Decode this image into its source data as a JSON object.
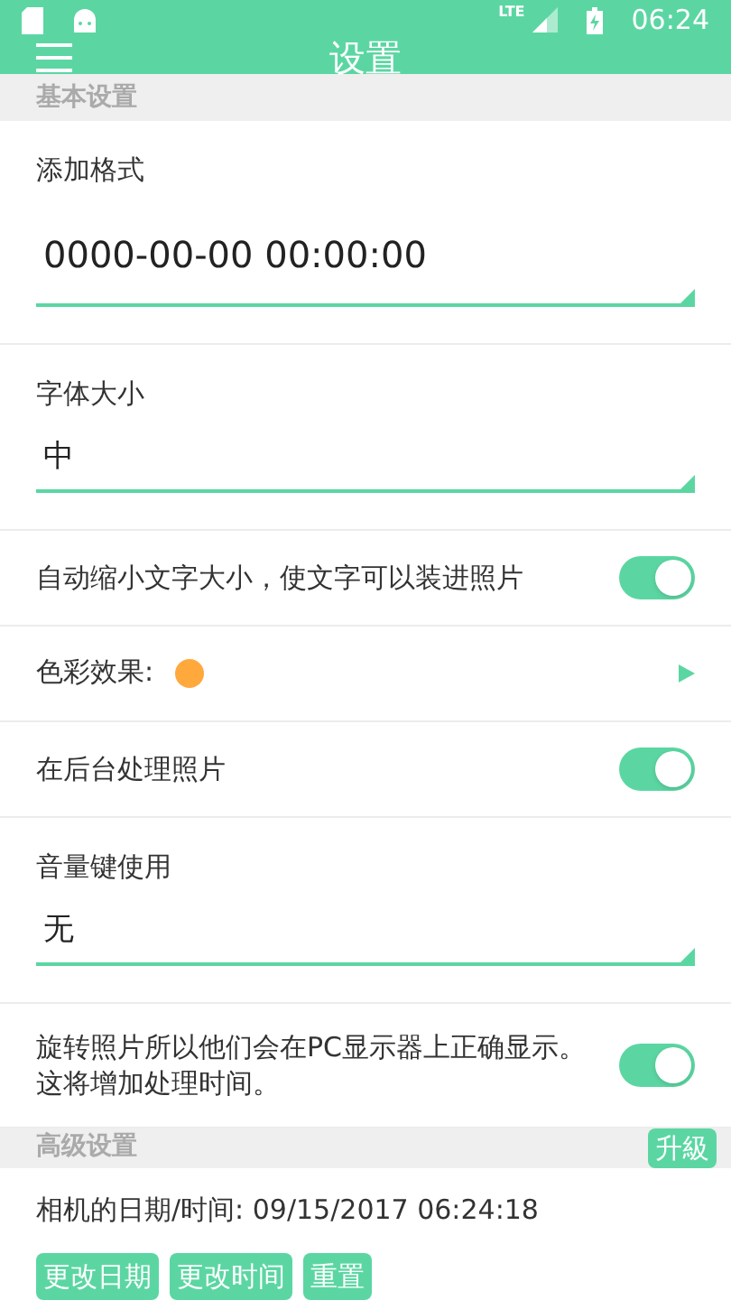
{
  "status_bar": {
    "time": "06:24",
    "network": "LTE"
  },
  "toolbar": {
    "title": "设置"
  },
  "sections": [
    {
      "header": "基本设置",
      "items": [
        {
          "kind": "field",
          "label": "添加格式",
          "value": "0000-00-00 00:00:00",
          "large": true
        },
        {
          "kind": "field",
          "label": "字体大小",
          "value": "中",
          "large": false
        },
        {
          "kind": "toggle",
          "label": "自动缩小文字大小，使文字可以装进照片",
          "on": true
        },
        {
          "kind": "color",
          "label": "色彩效果:",
          "color": "#ffa83c"
        },
        {
          "kind": "toggle",
          "label": "在后台处理照片",
          "on": true
        },
        {
          "kind": "field",
          "label": "音量键使用",
          "value": "无",
          "large": false
        },
        {
          "kind": "toggle",
          "label": "旋转照片所以他们会在PC显示器上正确显示。这将增加处理时间。",
          "on": true
        }
      ]
    }
  ],
  "advanced": {
    "header": "高级设置",
    "upgrade": "升級",
    "camera_time": "相机的日期/时间: 09/15/2017 06:24:18",
    "buttons": [
      "更改日期",
      "更改时间",
      "重置"
    ]
  }
}
